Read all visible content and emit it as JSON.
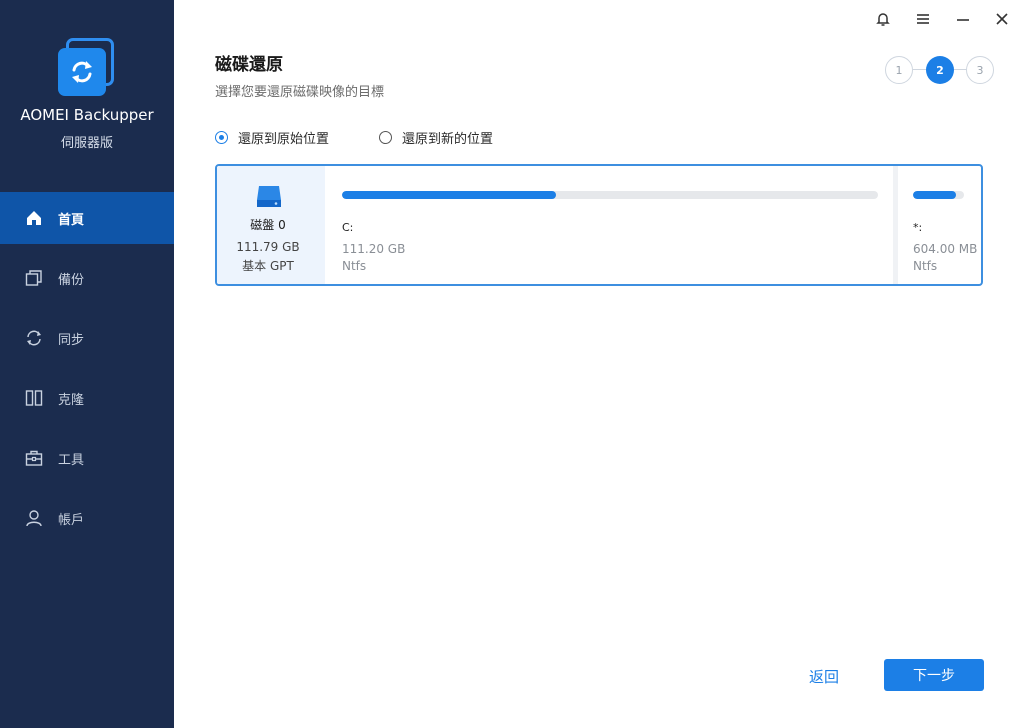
{
  "app": {
    "name": "AOMEI Backupper",
    "edition": "伺服器版"
  },
  "sidebar": {
    "items": [
      {
        "label": "首頁",
        "icon": "home-icon",
        "active": true
      },
      {
        "label": "備份",
        "icon": "backup-icon",
        "active": false
      },
      {
        "label": "同步",
        "icon": "sync-icon",
        "active": false
      },
      {
        "label": "克隆",
        "icon": "clone-icon",
        "active": false
      },
      {
        "label": "工具",
        "icon": "tools-icon",
        "active": false
      },
      {
        "label": "帳戶",
        "icon": "account-icon",
        "active": false
      }
    ]
  },
  "titlebar": {
    "icons": [
      "bell-icon",
      "menu-icon",
      "minimize-icon",
      "close-icon"
    ]
  },
  "header": {
    "title": "磁碟還原",
    "subtitle": "選擇您要還原磁碟映像的目標"
  },
  "steps": {
    "items": [
      "1",
      "2",
      "3"
    ],
    "current": 2
  },
  "options": {
    "original": {
      "label": "還原到原始位置",
      "checked": true
    },
    "new": {
      "label": "還原到新的位置",
      "checked": false
    }
  },
  "disk": {
    "name": "磁盤 0",
    "size": "111.79 GB",
    "type": "基本 GPT",
    "partitions": [
      {
        "label": "C:",
        "size": "111.20 GB",
        "fs": "Ntfs",
        "used_fraction": 0.4
      },
      {
        "label": "*:",
        "size": "604.00 MB",
        "fs": "Ntfs",
        "used_fraction": 0.85
      }
    ]
  },
  "buttons": {
    "back": "返回",
    "next": "下一步"
  },
  "colors": {
    "sidebar_bg": "#1b2c4e",
    "active_nav": "#0f55a8",
    "accent": "#1c7fe6"
  }
}
